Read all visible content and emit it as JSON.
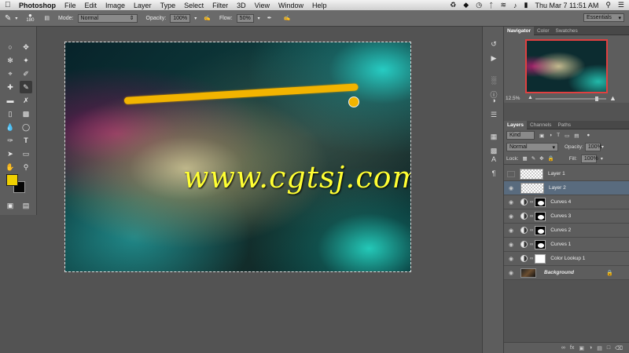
{
  "menubar": {
    "app_name": "Photoshop",
    "items": [
      "File",
      "Edit",
      "Image",
      "Layer",
      "Type",
      "Select",
      "Filter",
      "3D",
      "View",
      "Window",
      "Help"
    ],
    "clock": "Thu Mar 7  11:51 AM"
  },
  "options": {
    "brush_size": "180",
    "mode_label": "Mode:",
    "mode_value": "Normal",
    "opacity_label": "Opacity:",
    "opacity_value": "100%",
    "flow_label": "Flow:",
    "flow_value": "50%",
    "workspace": "Essentials"
  },
  "colors": {
    "foreground": "#f0d000",
    "background": "#050505",
    "stroke": "#f2b400"
  },
  "canvas": {
    "watermark": "www.cgtsj.com"
  },
  "navigator": {
    "tabs": [
      "Navigator",
      "Color",
      "Swatches"
    ],
    "zoom": "12.5%"
  },
  "layers_panel": {
    "tabs": [
      "Layers",
      "Channels",
      "Paths"
    ],
    "filter": "Kind",
    "blend_mode": "Normal",
    "opacity_label": "Opacity:",
    "opacity_value": "100%",
    "lock_label": "Lock:",
    "fill_label": "Fill:",
    "fill_value": "100%",
    "layers": [
      {
        "name": "Layer 1",
        "visible": false,
        "kind": "pixel"
      },
      {
        "name": "Layer 2",
        "visible": true,
        "kind": "pixel",
        "selected": true
      },
      {
        "name": "Curves 4",
        "visible": true,
        "kind": "adjustment"
      },
      {
        "name": "Curves 3",
        "visible": true,
        "kind": "adjustment"
      },
      {
        "name": "Curves 2",
        "visible": true,
        "kind": "adjustment"
      },
      {
        "name": "Curves 1",
        "visible": true,
        "kind": "adjustment"
      },
      {
        "name": "Color Lookup 1",
        "visible": true,
        "kind": "adjustment"
      },
      {
        "name": "Background",
        "visible": true,
        "kind": "background",
        "locked": true
      }
    ]
  }
}
